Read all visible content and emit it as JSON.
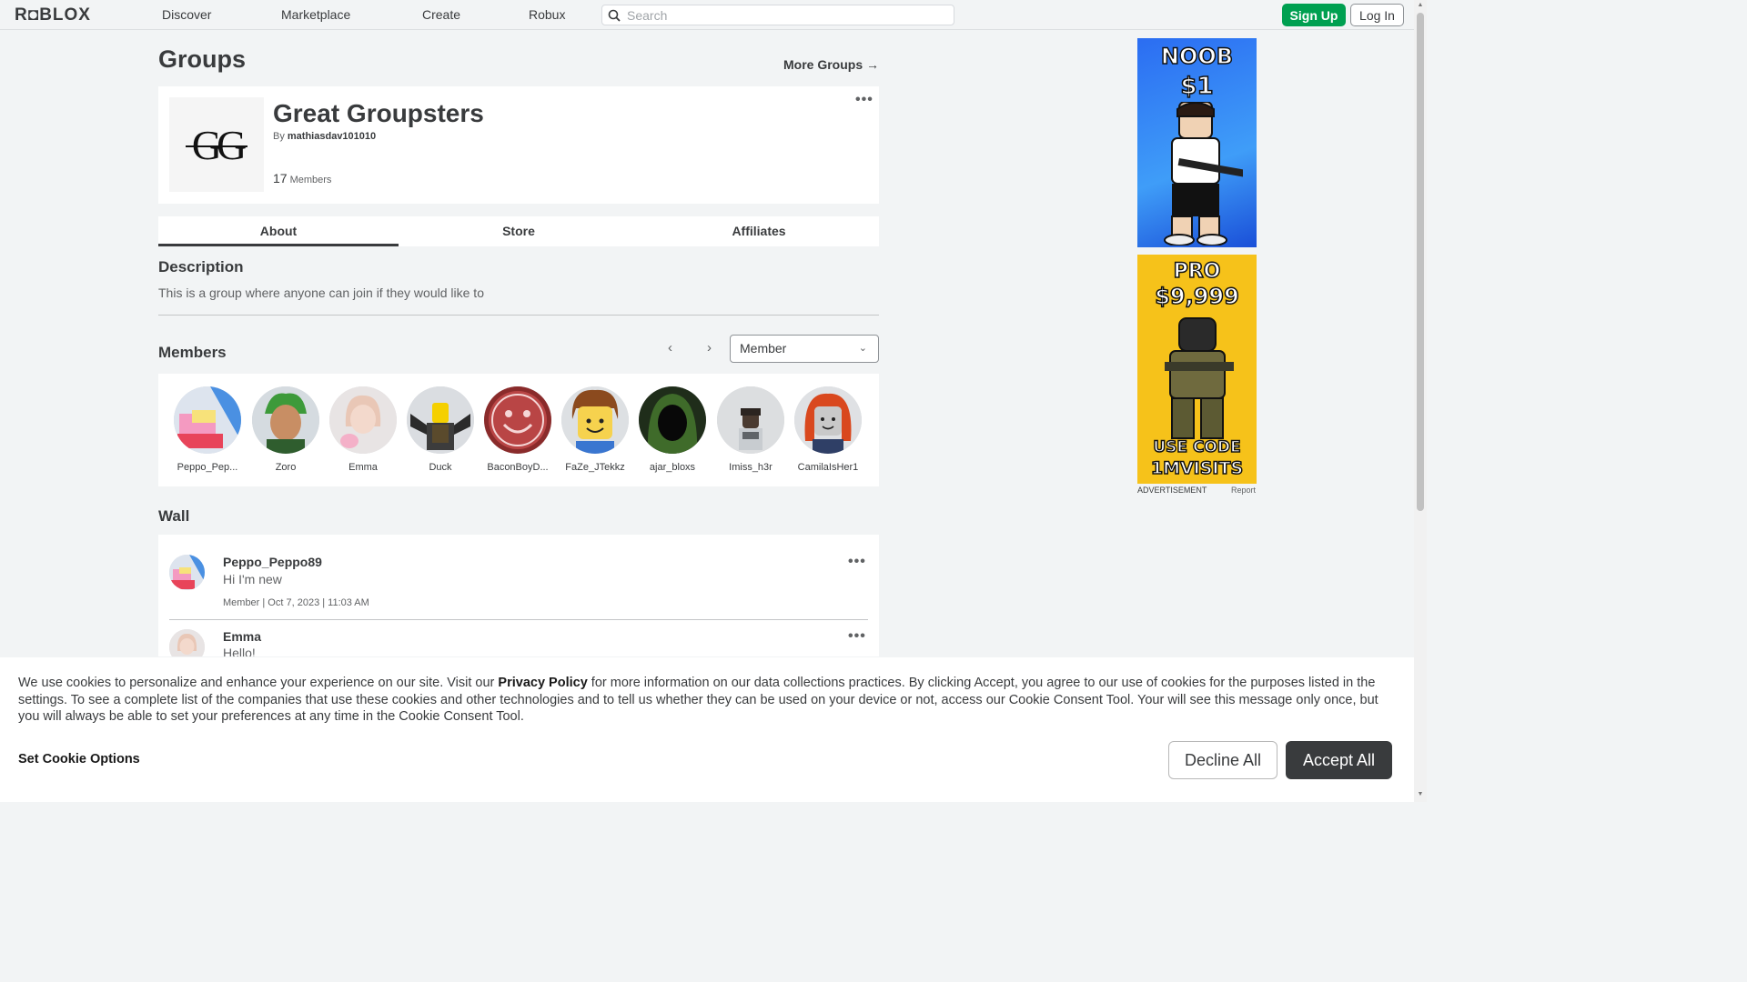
{
  "nav": {
    "logo": "R◘BLOX",
    "links": [
      "Discover",
      "Marketplace",
      "Create",
      "Robux"
    ],
    "search_placeholder": "Search",
    "signup": "Sign Up",
    "login": "Log In"
  },
  "page": {
    "title": "Groups",
    "more_groups": "More Groups →"
  },
  "group": {
    "logo_text": "GG",
    "name": "Great Groupsters",
    "by_prefix": "By ",
    "owner": "mathiasdav101010",
    "member_count": "17",
    "members_label": "Members"
  },
  "tabs": [
    "About",
    "Store",
    "Affiliates"
  ],
  "about": {
    "description_title": "Description",
    "description": "This is a group where anyone can join if they would like to"
  },
  "members": {
    "title": "Members",
    "prev": "‹",
    "next": "›",
    "role_selected": "Member",
    "list": [
      {
        "name": "Peppo_Pep..."
      },
      {
        "name": "Zoro"
      },
      {
        "name": "Emma"
      },
      {
        "name": "Duck"
      },
      {
        "name": "BaconBoyD..."
      },
      {
        "name": "FaZe_JTekkz"
      },
      {
        "name": "ajar_bloxs"
      },
      {
        "name": "Imiss_h3r"
      },
      {
        "name": "CamilaIsHer1"
      }
    ]
  },
  "wall": {
    "title": "Wall",
    "posts": [
      {
        "author": "Peppo_Peppo89",
        "body": "Hi I'm new",
        "meta": "Member | Oct 7, 2023 | 11:03 AM"
      },
      {
        "author": "Emma",
        "body": "Hello!",
        "meta": ""
      }
    ]
  },
  "ads": {
    "ad1_line1": "NOOB",
    "ad1_line2": "$1",
    "ad2_line1": "PRO",
    "ad2_line2": "$9,999",
    "ad2_line3": "USE CODE",
    "ad2_line4": "1MVISITS",
    "label": "ADVERTISEMENT",
    "report": "Report"
  },
  "cookie": {
    "text_a": "We use cookies to personalize and enhance your experience on our site. Visit our ",
    "privacy": "Privacy Policy",
    "text_b": " for more information on our data collections practices. By clicking Accept, you agree to our use of cookies for the purposes listed in the settings. To see a complete list of the companies that use these cookies and other technologies and to tell us whether they can be used on your device or not, access our Cookie Consent Tool. Your will see this message only once, but you will always be able to set your preferences at any time in the Cookie Consent Tool.",
    "options": "Set Cookie Options",
    "decline": "Decline All",
    "accept": "Accept All"
  },
  "colors": {
    "signup_green": "#00a051",
    "accept_dark": "#393b3d",
    "background": "#f2f4f5"
  }
}
